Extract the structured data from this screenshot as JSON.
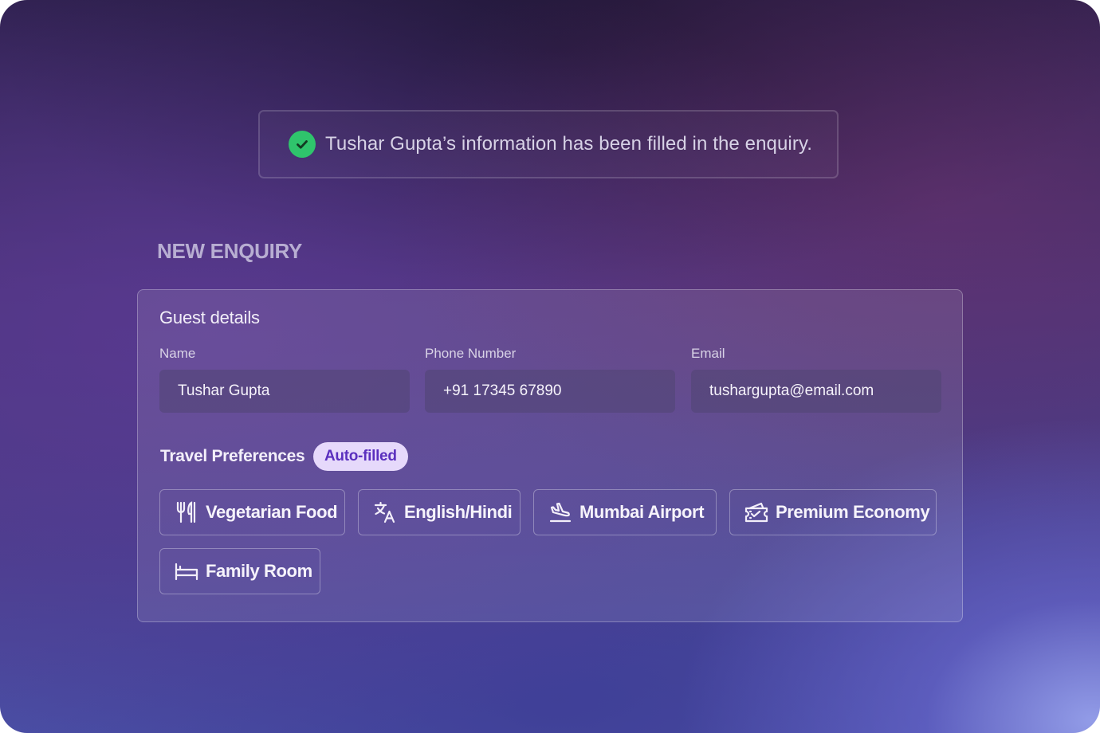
{
  "notification": {
    "message": "Tushar Gupta’s information has been filled in the enquiry.",
    "icon": "check-circle-icon",
    "icon_color": "#2fc46c"
  },
  "page": {
    "title": "NEW ENQUIRY"
  },
  "guest_details": {
    "title": "Guest details",
    "fields": {
      "name": {
        "label": "Name",
        "value": "Tushar Gupta"
      },
      "phone": {
        "label": "Phone Number",
        "value": "+91 17345 67890"
      },
      "email": {
        "label": "Email",
        "value": "tushargupta@email.com"
      }
    }
  },
  "travel_preferences": {
    "title": "Travel Preferences",
    "badge": "Auto-filled",
    "badge_color": "#5a2fbe",
    "chips": [
      {
        "label": "Vegetarian Food",
        "icon": "utensils-icon"
      },
      {
        "label": "English/Hindi",
        "icon": "translate-icon"
      },
      {
        "label": "Mumbai Airport",
        "icon": "plane-landing-icon"
      },
      {
        "label": "Premium Economy",
        "icon": "ticket-icon"
      },
      {
        "label": "Family Room",
        "icon": "bed-icon"
      }
    ]
  }
}
